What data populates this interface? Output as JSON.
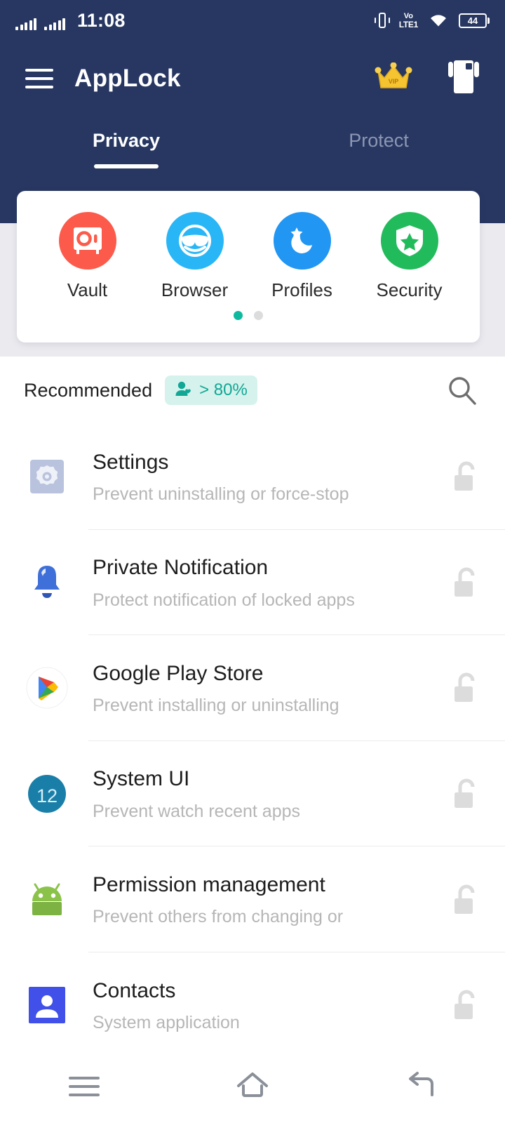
{
  "status_bar": {
    "time": "11:08",
    "network_label": "VoLTE1",
    "volte_top": "Vo",
    "volte_bottom": "LTE1",
    "battery_level": "44",
    "icons": [
      "signal-icon",
      "signal-icon",
      "vibrate-icon",
      "volte-icon",
      "wifi-icon",
      "battery-icon"
    ]
  },
  "header": {
    "title": "AppLock",
    "menu_icon": "hamburger-menu-icon",
    "vip_icon": "vip-crown-icon",
    "vip_label": "VIP",
    "theme_icon": "theme-shirt-icon"
  },
  "tabs": [
    {
      "label": "Privacy",
      "active": true
    },
    {
      "label": "Protect",
      "active": false
    }
  ],
  "feature_card": {
    "items": [
      {
        "label": "Vault",
        "icon": "vault-safe-icon",
        "color": "#FC5A4B"
      },
      {
        "label": "Browser",
        "icon": "incognito-mask-icon",
        "color": "#29B6F6"
      },
      {
        "label": "Profiles",
        "icon": "moon-star-icon",
        "color": "#2196F3"
      },
      {
        "label": "Security",
        "icon": "shield-star-icon",
        "color": "#22BB5B"
      }
    ],
    "page_dots": {
      "count": 2,
      "active_index": 0,
      "active_color": "#0FB9A0",
      "inactive_color": "#DCDCDC"
    }
  },
  "recommended": {
    "label": "Recommended",
    "badge_text": "> 80%",
    "badge_icon": "person-heart-icon",
    "badge_bg": "#D6F2EC",
    "badge_color": "#12A795",
    "search_icon": "search-icon"
  },
  "app_list": [
    {
      "title": "Settings",
      "subtitle": "Prevent uninstalling or force-stop",
      "icon": "settings-gear-icon",
      "lock_state": "unlocked"
    },
    {
      "title": "Private Notification",
      "subtitle": "Protect notification of locked apps",
      "icon": "notification-bell-icon",
      "lock_state": "unlocked"
    },
    {
      "title": "Google Play Store",
      "subtitle": "Prevent installing or uninstalling",
      "icon": "google-play-icon",
      "lock_state": "unlocked"
    },
    {
      "title": "System UI",
      "subtitle": "Prevent watch recent apps",
      "icon": "android-12-icon",
      "lock_state": "unlocked"
    },
    {
      "title": "Permission management",
      "subtitle": "Prevent others from changing or",
      "icon": "android-robot-icon",
      "lock_state": "unlocked"
    },
    {
      "title": "Contacts",
      "subtitle": "System application",
      "icon": "contacts-person-icon",
      "lock_state": "unlocked"
    }
  ],
  "nav_bar": {
    "recents_icon": "recents-icon",
    "home_icon": "home-icon",
    "back_icon": "back-icon"
  },
  "theme": {
    "header_bg": "#273761",
    "band_bg": "#EBEBEF",
    "content_bg": "#FFFFFF",
    "lock_gray": "#DCDCDC"
  }
}
